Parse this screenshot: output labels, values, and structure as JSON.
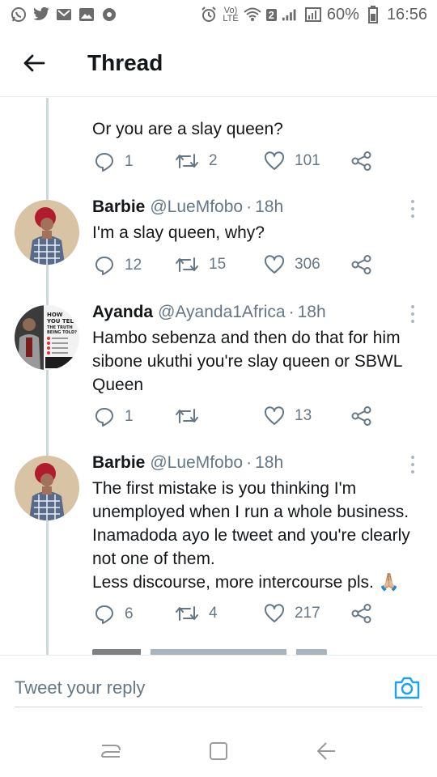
{
  "statusbar": {
    "left_icons": [
      "whatsapp-icon",
      "twitter-icon",
      "gmail-icon",
      "gallery-icon",
      "video-icon"
    ],
    "volte_top": "Vo)",
    "volte_bottom": "LTE",
    "sim_badge": "2",
    "battery": "60%",
    "time": "16:56"
  },
  "header": {
    "title": "Thread"
  },
  "tweets": [
    {
      "text": "Or you are a slay queen?",
      "reply_count": "1",
      "retweet_count": "2",
      "like_count": "101"
    },
    {
      "name": "Barbie",
      "handle": "@LueMfobo",
      "dot": "·",
      "time": "18h",
      "text": "I'm a slay queen, why?",
      "reply_count": "12",
      "retweet_count": "15",
      "like_count": "306"
    },
    {
      "name": "Ayanda",
      "handle": "@Ayanda1Africa",
      "dot": "·",
      "time": "18h",
      "text": "Hambo sebenza and then do that for him sibone ukuthi you're slay queen or SBWL Queen",
      "reply_count": "1",
      "retweet_count": "",
      "like_count": "13",
      "avatar_text": "HOW YOU TELL THE TRUTH IS BEING TOLD?"
    },
    {
      "name": "Barbie",
      "handle": "@LueMfobo",
      "dot": "·",
      "time": "18h",
      "text": "The first mistake is you thinking I'm unemployed when I run a whole business. Inamadoda ayo le tweet and you're clearly not one of them.\nLess discourse, more intercourse pls. 🙏🏼",
      "reply_count": "6",
      "retweet_count": "4",
      "like_count": "217"
    }
  ],
  "reply": {
    "placeholder": "Tweet your reply"
  },
  "colors": {
    "accent": "#1da1f2",
    "secondary_text": "#657786",
    "thread_line": "#ccd6dd"
  }
}
